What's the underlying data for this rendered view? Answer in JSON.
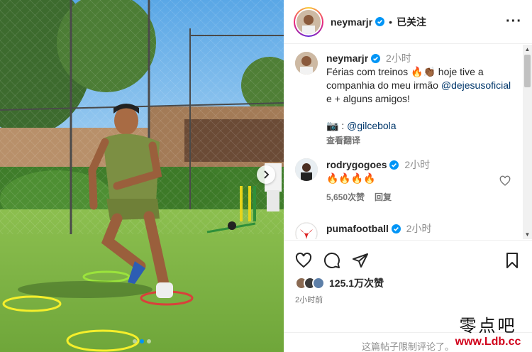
{
  "post": {
    "author": "neymarjr",
    "follow_state": "已关注",
    "separator": "•",
    "more_icon": "more-horizontal-icon",
    "verified_color": "#0095f6"
  },
  "caption": {
    "username": "neymarjr",
    "time": "2小时",
    "text_1": "Férias com treinos 🔥👏🏾 hoje tive a companhia do meu irmão",
    "mention": "@dejesusoficial",
    "text_2": " e + alguns amigos!",
    "photo_credit_prefix": "📷 : ",
    "photo_credit": "@gilcebola",
    "translate": "查看翻译"
  },
  "comments": [
    {
      "username": "rodrygogoes",
      "time": "2小时",
      "text": "🔥🔥🔥🔥",
      "likes": "5,650次赞",
      "reply": "回复"
    },
    {
      "username": "pumafootball",
      "time": "2小时",
      "text": ""
    }
  ],
  "actions": {
    "like_icon": "heart-icon",
    "comment_icon": "comment-icon",
    "share_icon": "share-icon",
    "save_icon": "bookmark-icon"
  },
  "likes_count": "125.1万次赞",
  "posted_time": "2小时前",
  "comments_restricted": "这篇帖子限制评论了。",
  "carousel": {
    "dots": 3,
    "active": 1
  },
  "watermark": {
    "chinese": "零点吧",
    "url": "www.Ldb.cc"
  }
}
